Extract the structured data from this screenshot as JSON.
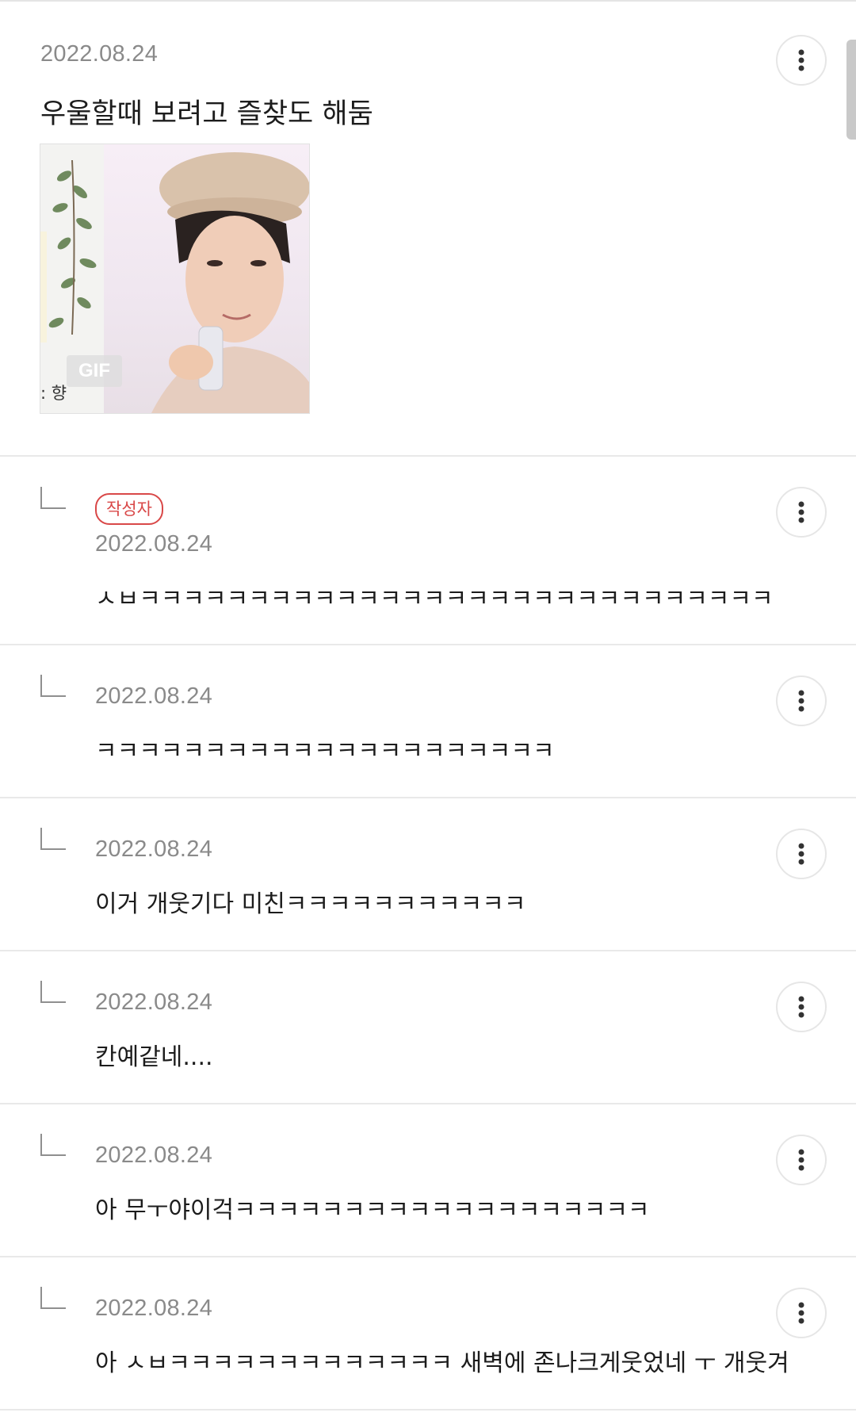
{
  "post": {
    "date": "2022.08.24",
    "text": "우울할때 보려고 즐찾도 해둠",
    "media": {
      "badge": "GIF",
      "caption": ": 향"
    }
  },
  "replies": [
    {
      "badge": "작성자",
      "date": "2022.08.24",
      "text": "ㅅㅂㅋㅋㅋㅋㅋㅋㅋㅋㅋㅋㅋㅋㅋㅋㅋㅋㅋㅋㅋㅋㅋㅋㅋㅋㅋㅋㅋㅋㅋ"
    },
    {
      "date": "2022.08.24",
      "text": "ㅋㅋㅋㅋㅋㅋㅋㅋㅋㅋㅋㅋㅋㅋㅋㅋㅋㅋㅋㅋㅋ"
    },
    {
      "date": "2022.08.24",
      "text": "이거 개웃기다 미친ㅋㅋㅋㅋㅋㅋㅋㅋㅋㅋㅋ"
    },
    {
      "date": "2022.08.24",
      "text": "칸예같네...."
    },
    {
      "date": "2022.08.24",
      "text": "아 무ㅜ야이걱ㅋㅋㅋㅋㅋㅋㅋㅋㅋㅋㅋㅋㅋㅋㅋㅋㅋㅋㅋ"
    },
    {
      "date": "2022.08.24",
      "text": "아 ㅅㅂㅋㅋㅋㅋㅋㅋㅋㅋㅋㅋㅋㅋㅋ 새벽에 존나크게웃었네 ㅜ 개웃겨"
    }
  ],
  "icons": {
    "more": "vertical-ellipsis-icon",
    "reply_indicator": "reply-corner-icon"
  },
  "colors": {
    "author_badge": "#d94848",
    "date_gray": "#8a8a8a"
  }
}
